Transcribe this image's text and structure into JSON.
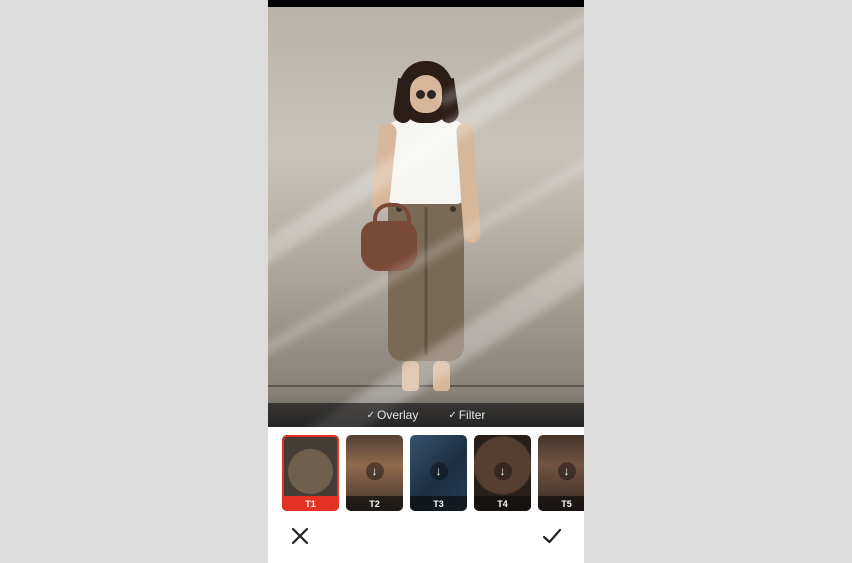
{
  "options": {
    "overlay_label": "Overlay",
    "filter_label": "Filter"
  },
  "thumbs": [
    {
      "label": "T1",
      "selected": true,
      "needs_download": false
    },
    {
      "label": "T2",
      "selected": false,
      "needs_download": true
    },
    {
      "label": "T3",
      "selected": false,
      "needs_download": true
    },
    {
      "label": "T4",
      "selected": false,
      "needs_download": true
    },
    {
      "label": "T5",
      "selected": false,
      "needs_download": true
    }
  ]
}
